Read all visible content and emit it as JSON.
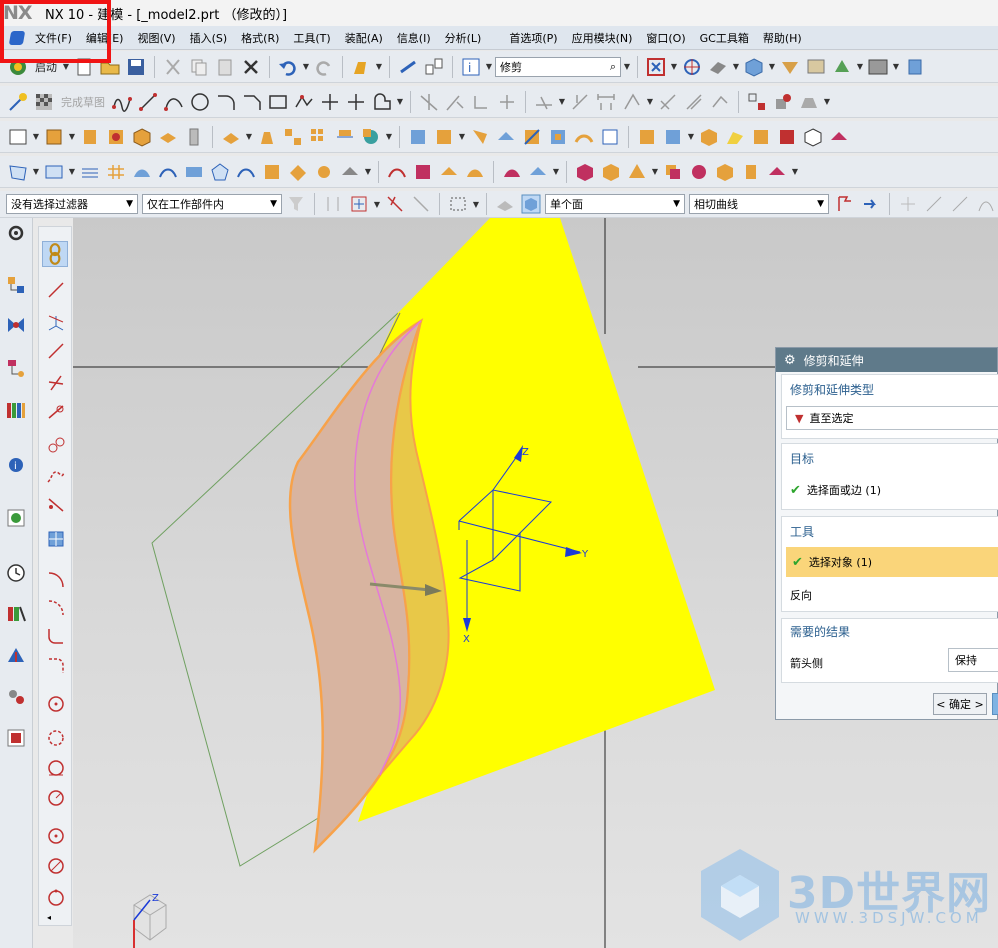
{
  "window": {
    "logo": "NX",
    "title": "NX 10 - 建模 - [_model2.prt （修改的）]"
  },
  "menu": {
    "items": [
      "文件(F)",
      "编辑(E)",
      "视图(V)",
      "插入(S)",
      "格式(R)",
      "工具(T)",
      "装配(A)",
      "信息(I)",
      "分析(L)"
    ],
    "items_right": [
      "首选项(P)",
      "应用模块(N)",
      "窗口(O)",
      "GC工具箱",
      "帮助(H)"
    ]
  },
  "toolbar1": {
    "start_label": "启动",
    "command_search_value": "修剪"
  },
  "toolbar2": {
    "finish_sketch_label": "完成草图"
  },
  "selection_bar": {
    "type_filter": "没有选择过滤器",
    "scope": "仅在工作部件内",
    "face_rule": "单个面",
    "curve_rule": "相切曲线"
  },
  "dialog": {
    "title": "修剪和延伸",
    "type_group_title": "修剪和延伸类型",
    "type_value": "直至选定",
    "target_group_title": "目标",
    "target_select": "选择面或边 (1)",
    "tool_group_title": "工具",
    "tool_select": "选择对象 (1)",
    "reverse_label": "反向",
    "result_group_title": "需要的结果",
    "arrow_side_label": "箭头侧",
    "arrow_side_value": "保持",
    "ok_label": "< 确定 >"
  },
  "csys": {
    "x": "X",
    "y": "Y",
    "z": "Z"
  },
  "watermark": {
    "text": "3D世界网",
    "sub": "WWW.3DSJW.COM"
  },
  "colors": {
    "yellow_sheet": "#ffff00",
    "orange_edge": "#f7a24a",
    "dialog_header": "#5f7a8a",
    "selected_row": "#fad57a",
    "highlight_box": "#f01414"
  }
}
